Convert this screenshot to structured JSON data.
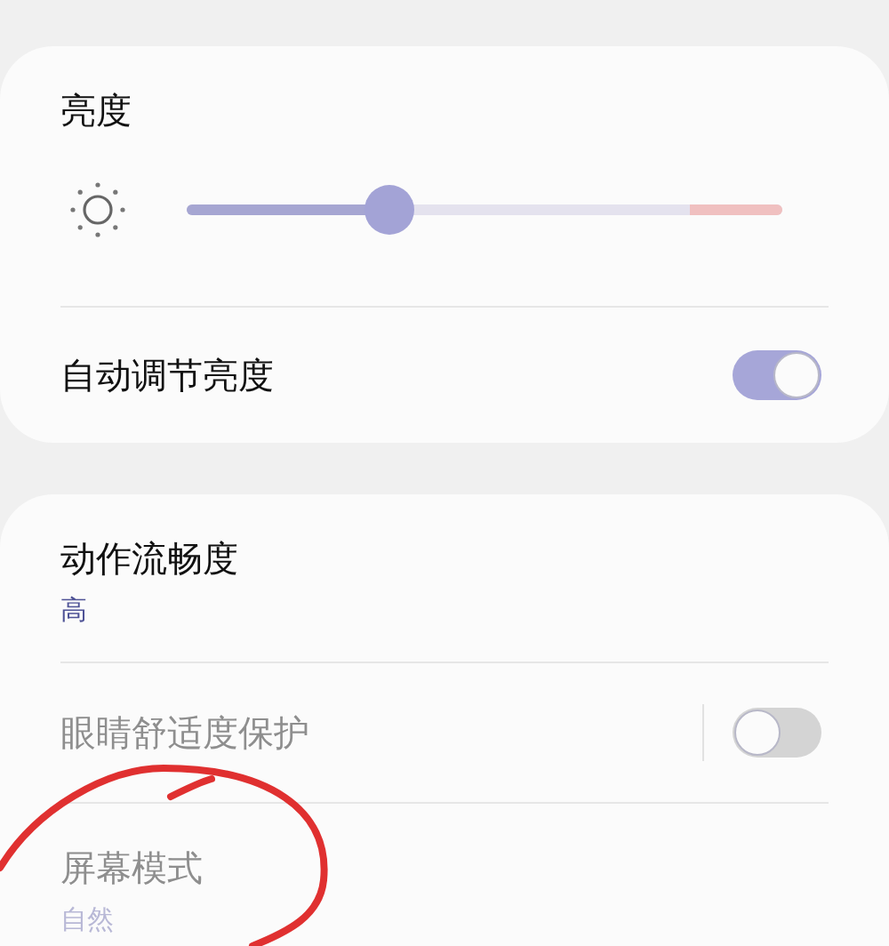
{
  "brightness": {
    "title": "亮度",
    "level": 0.34,
    "auto": {
      "label": "自动调节亮度",
      "on": true
    }
  },
  "display": {
    "items": [
      {
        "kind": "value",
        "label": "动作流畅度",
        "value": "高",
        "disabled": false
      },
      {
        "kind": "toggle",
        "label": "眼睛舒适度保护",
        "on": false,
        "disabled": true
      },
      {
        "kind": "value",
        "label": "屏幕模式",
        "value": "自然",
        "disabled": true
      }
    ]
  }
}
